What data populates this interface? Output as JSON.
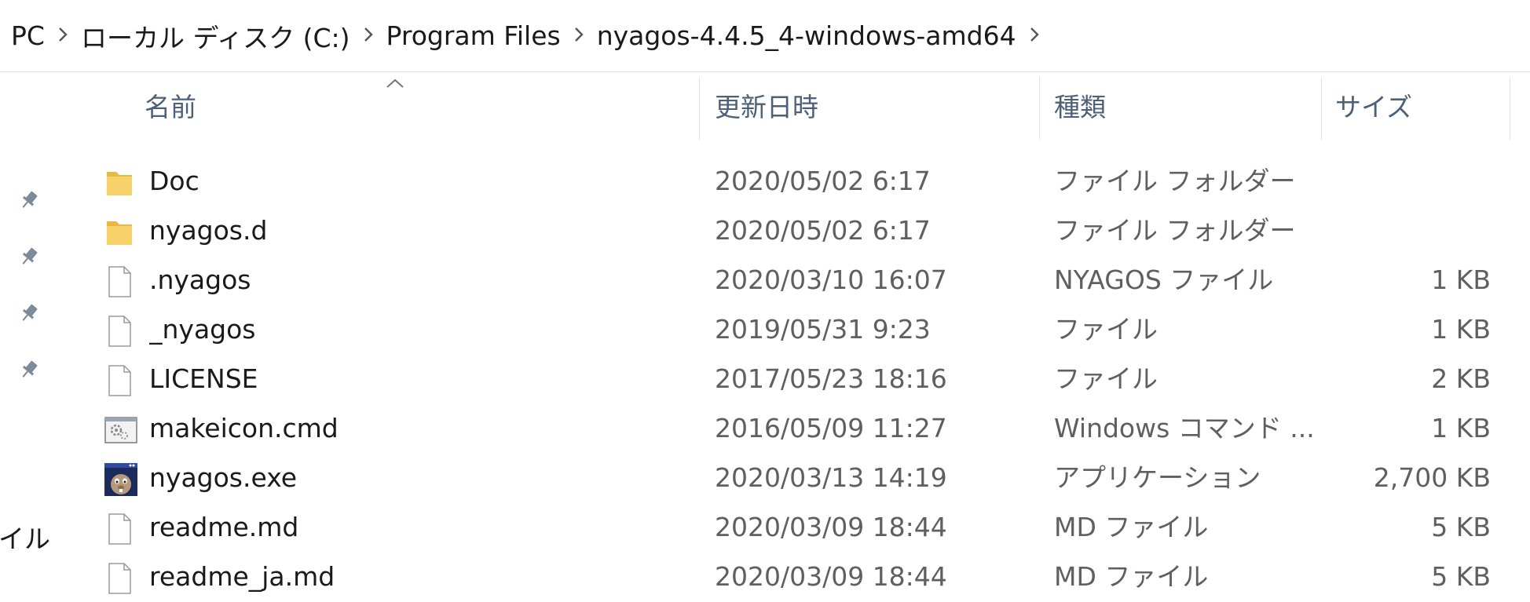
{
  "breadcrumb": {
    "items": [
      {
        "label": "PC"
      },
      {
        "label": "ローカル ディスク (C:)"
      },
      {
        "label": "Program Files"
      },
      {
        "label": "nyagos-4.4.5_4-windows-amd64"
      }
    ]
  },
  "nav": {
    "partial_label": "ファイル"
  },
  "columns": {
    "name": "名前",
    "date": "更新日時",
    "type": "種類",
    "size": "サイズ"
  },
  "files": [
    {
      "name": "Doc",
      "date": "2020/05/02 6:17",
      "type": "ファイル フォルダー",
      "size": "",
      "icon": "folder-icon"
    },
    {
      "name": "nyagos.d",
      "date": "2020/05/02 6:17",
      "type": "ファイル フォルダー",
      "size": "",
      "icon": "folder-icon"
    },
    {
      "name": ".nyagos",
      "date": "2020/03/10 16:07",
      "type": "NYAGOS ファイル",
      "size": "1 KB",
      "icon": "file-icon"
    },
    {
      "name": "_nyagos",
      "date": "2019/05/31 9:23",
      "type": "ファイル",
      "size": "1 KB",
      "icon": "file-icon"
    },
    {
      "name": "LICENSE",
      "date": "2017/05/23 18:16",
      "type": "ファイル",
      "size": "2 KB",
      "icon": "file-icon"
    },
    {
      "name": "makeicon.cmd",
      "date": "2016/05/09 11:27",
      "type": "Windows コマンド ...",
      "size": "1 KB",
      "icon": "cmd-script-icon"
    },
    {
      "name": "nyagos.exe",
      "date": "2020/03/13 14:19",
      "type": "アプリケーション",
      "size": "2,700 KB",
      "icon": "app-exe-icon"
    },
    {
      "name": "readme.md",
      "date": "2020/03/09 18:44",
      "type": "MD ファイル",
      "size": "5 KB",
      "icon": "file-icon"
    },
    {
      "name": "readme_ja.md",
      "date": "2020/03/09 18:44",
      "type": "MD ファイル",
      "size": "5 KB",
      "icon": "file-icon"
    }
  ],
  "colors": {
    "header_text": "#4c607a",
    "folder_yellow": "#f7d26b",
    "secondary_text": "#5f5f5f"
  }
}
